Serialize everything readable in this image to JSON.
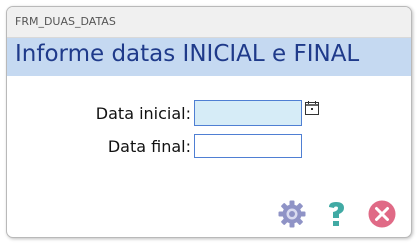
{
  "window": {
    "title": "FRM_DUAS_DATAS"
  },
  "header": {
    "heading": "Informe datas INICIAL e FINAL"
  },
  "form": {
    "start_date": {
      "label": "Data inicial:",
      "value": "",
      "placeholder": ""
    },
    "end_date": {
      "label": "Data final:",
      "value": "",
      "placeholder": ""
    }
  },
  "icons": {
    "calendar": "calendar-icon",
    "settings": "gear-icon",
    "help": "question-mark-icon",
    "close": "close-icon"
  },
  "colors": {
    "header_band": "#c5d9f1",
    "heading_text": "#1f3a8a",
    "active_field_bg": "#d6ecf7",
    "field_border": "#4f7fd3",
    "gear": "#8f93c6",
    "help": "#41aaa4",
    "close": "#e06a86"
  }
}
